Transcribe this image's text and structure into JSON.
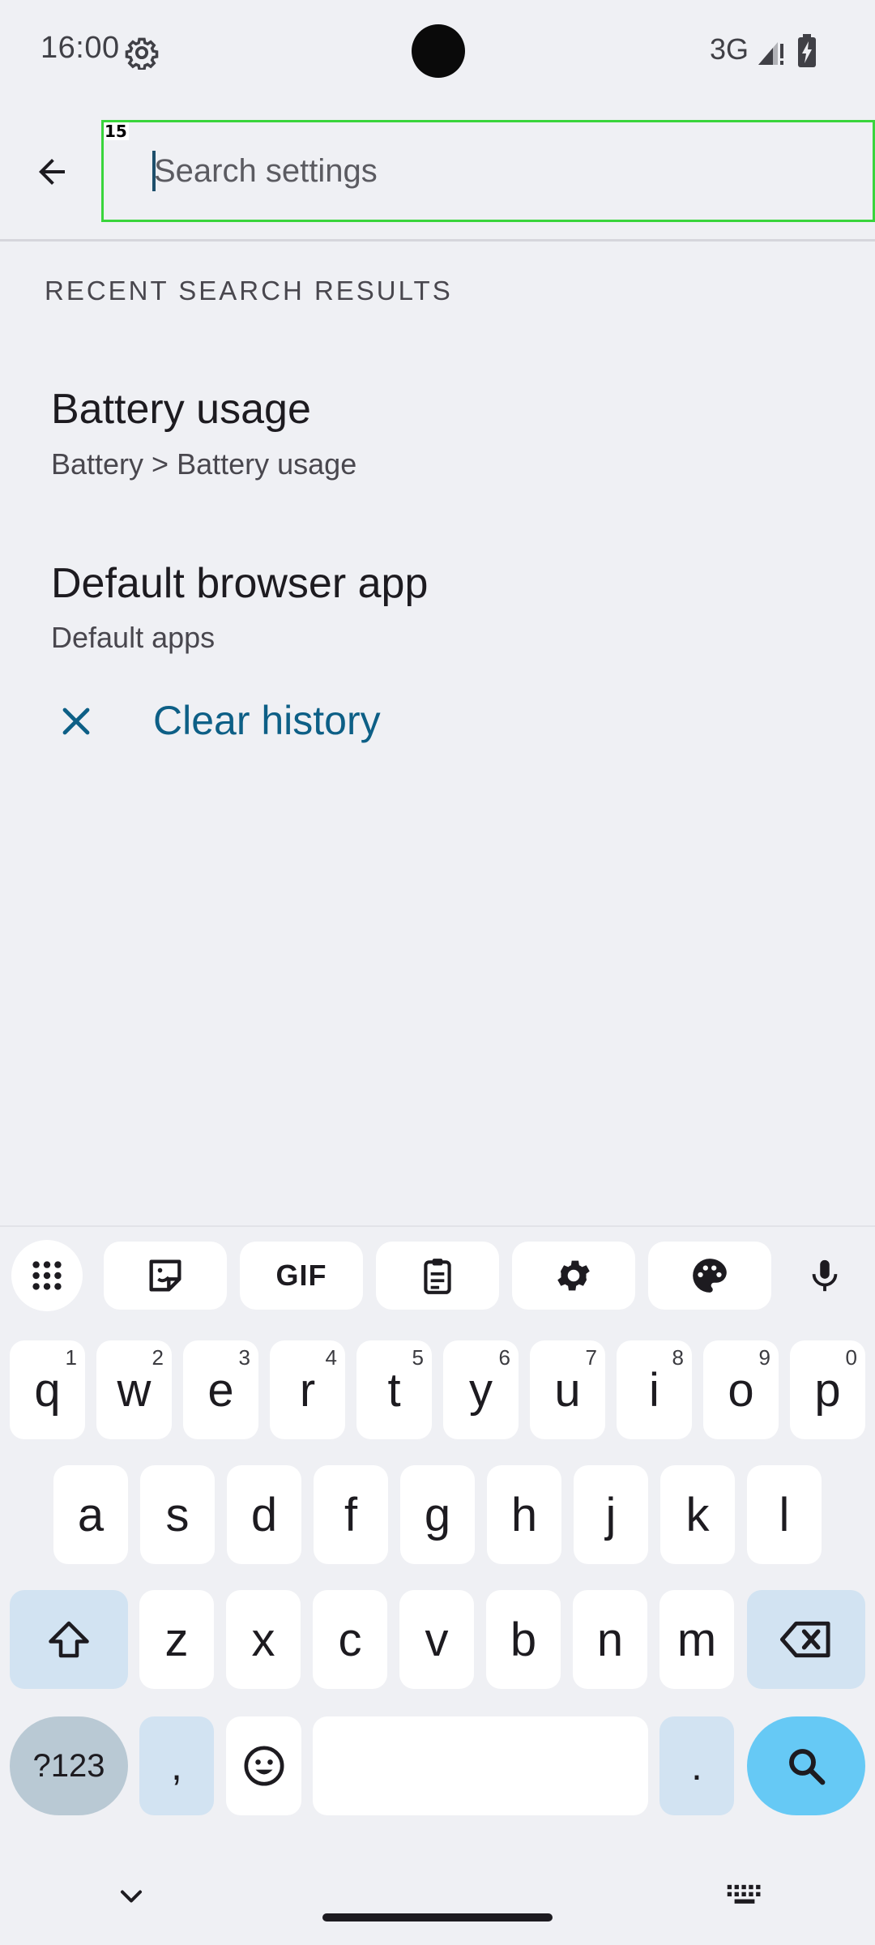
{
  "status_bar": {
    "time": "16:00",
    "network": "3G",
    "icons": [
      "gear-icon",
      "signal-icon",
      "battery-charging-icon"
    ]
  },
  "search": {
    "placeholder": "Search settings",
    "value": "",
    "overlay_badge": "15"
  },
  "recent": {
    "header": "RECENT SEARCH RESULTS",
    "results": [
      {
        "title": "Battery usage",
        "subtitle": "Battery > Battery usage"
      },
      {
        "title": "Default browser app",
        "subtitle": "Default apps"
      }
    ],
    "clear_label": "Clear history"
  },
  "keyboard": {
    "toolbar": [
      "apps-grid-icon",
      "sticker-icon",
      "gif-icon",
      "clipboard-icon",
      "settings-icon",
      "palette-icon",
      "mic-icon"
    ],
    "gif_label": "GIF",
    "row1": [
      {
        "k": "q",
        "h": "1"
      },
      {
        "k": "w",
        "h": "2"
      },
      {
        "k": "e",
        "h": "3"
      },
      {
        "k": "r",
        "h": "4"
      },
      {
        "k": "t",
        "h": "5"
      },
      {
        "k": "y",
        "h": "6"
      },
      {
        "k": "u",
        "h": "7"
      },
      {
        "k": "i",
        "h": "8"
      },
      {
        "k": "o",
        "h": "9"
      },
      {
        "k": "p",
        "h": "0"
      }
    ],
    "row2": [
      "a",
      "s",
      "d",
      "f",
      "g",
      "h",
      "j",
      "k",
      "l"
    ],
    "row3": [
      "z",
      "x",
      "c",
      "v",
      "b",
      "n",
      "m"
    ],
    "sym_label": "?123",
    "comma": ",",
    "period": "."
  },
  "colors": {
    "accent": "#0d5f86",
    "highlight_border": "#3ad53c",
    "search_key": "#66c9f5"
  }
}
